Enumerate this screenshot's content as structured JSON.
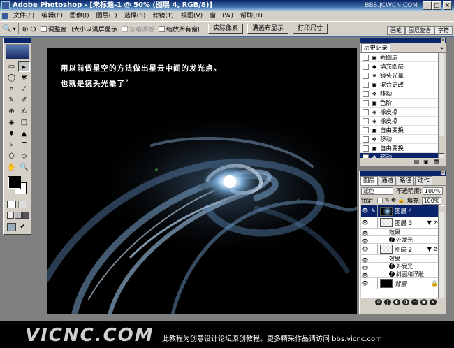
{
  "window": {
    "title": "Adobe Photoshop - [未标题-1 @ 50% (图层 4, RGB/8)]",
    "site": "BBS.JCWCN.COM",
    "min": "_",
    "max": "□",
    "close": "×"
  },
  "menu": [
    "文件(F)",
    "编辑(E)",
    "图像(I)",
    "图层(L)",
    "选择(S)",
    "滤镜(T)",
    "视图(V)",
    "窗口(W)",
    "帮助(H)"
  ],
  "options": {
    "zoom_tool": "🔍",
    "resize_windows": "调整窗口大小以满屏显示",
    "ignore_palettes": "忽略调板",
    "zoom_all": "缩放所有窗口",
    "actual_pixels": "实际像素",
    "fit_on_screen": "满画布显示",
    "print_size": "打印尺寸",
    "palette_well": [
      "画笔",
      "图层复合",
      "字符"
    ]
  },
  "tools": [
    "▭",
    "▸",
    "◯",
    "✱",
    "⌗",
    "⁄",
    "✎",
    "✐",
    "⊕",
    "✍",
    "◈",
    "◫",
    "♦",
    "▲",
    "▹",
    "T",
    "⬡",
    "◇",
    "✋",
    "🔍"
  ],
  "canvas": {
    "line1": "用以前做星空的方法做出星云中间的发光点。",
    "line2": "也就是镜头光晕了˚"
  },
  "history": {
    "tab": "历史记录",
    "items": [
      {
        "icon": "▣",
        "label": "新图层",
        "selected": false
      },
      {
        "icon": "◆",
        "label": "填充图层",
        "selected": false
      },
      {
        "icon": "✷",
        "label": "镜头光晕",
        "selected": false
      },
      {
        "icon": "▣",
        "label": "混合更改",
        "selected": false
      },
      {
        "icon": "✥",
        "label": "移动",
        "selected": false
      },
      {
        "icon": "▣",
        "label": "色阶",
        "selected": false
      },
      {
        "icon": "◈",
        "label": "橡皮擦",
        "selected": false
      },
      {
        "icon": "◈",
        "label": "橡皮擦",
        "selected": false
      },
      {
        "icon": "▣",
        "label": "自由变换",
        "selected": false
      },
      {
        "icon": "✥",
        "label": "移动",
        "selected": false
      },
      {
        "icon": "▣",
        "label": "自由变换",
        "selected": false
      },
      {
        "icon": "✥",
        "label": "移动",
        "selected": true
      }
    ]
  },
  "layers": {
    "tabs": [
      "图层",
      "通道",
      "路径",
      "动作"
    ],
    "blend_mode": "滤色",
    "opacity_label": "不透明度:",
    "opacity": "100%",
    "lock_label": "锁定:",
    "fill_label": "填充:",
    "fill": "100%",
    "rows": [
      {
        "kind": "layer",
        "name": "图层 4",
        "thumb": "galaxy",
        "selected": true,
        "fx": ""
      },
      {
        "kind": "layer",
        "name": "图层 3",
        "thumb": "trans",
        "selected": false,
        "fx": "▼ ⊘"
      },
      {
        "kind": "effect",
        "name": "效果"
      },
      {
        "kind": "fxitem",
        "name": "外发光"
      },
      {
        "kind": "layer",
        "name": "图层 2",
        "thumb": "trans",
        "selected": false,
        "fx": "▼ ⊘"
      },
      {
        "kind": "effect",
        "name": "效果"
      },
      {
        "kind": "fxitem",
        "name": "外发光"
      },
      {
        "kind": "fxitem",
        "name": "斜面和浮雕"
      },
      {
        "kind": "layer",
        "name": "背景",
        "thumb": "black",
        "selected": false,
        "fx": "🔒",
        "italic": true
      }
    ]
  },
  "banner": {
    "logo": "VICNC.COM",
    "text": "此教程为创意设计论坛原创教程。更多精采作品请访问 bbs.vicnc.com"
  },
  "colors": {
    "titlebar": "#0a246a",
    "chrome": "#d4d0c8",
    "workspace": "#808080",
    "selection": "#0a246a"
  }
}
